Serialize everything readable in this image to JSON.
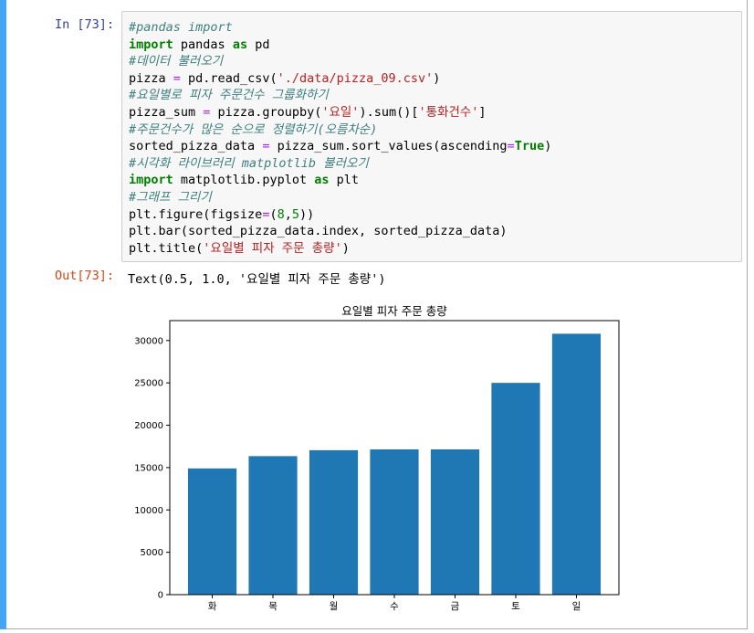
{
  "notebook": {
    "in_prompt": "In [73]:",
    "out_prompt": "Out[73]:",
    "code_lines": [
      [
        {
          "t": "#pandas import",
          "c": "cm-comment"
        }
      ],
      [
        {
          "t": "import",
          "c": "cm-keyword"
        },
        {
          "t": " pandas ",
          "c": ""
        },
        {
          "t": "as",
          "c": "cm-keyword"
        },
        {
          "t": " pd",
          "c": ""
        }
      ],
      [
        {
          "t": "#데이터 불러오기",
          "c": "cm-comment"
        }
      ],
      [
        {
          "t": "pizza ",
          "c": ""
        },
        {
          "t": "=",
          "c": "cm-operator"
        },
        {
          "t": " pd.read_csv(",
          "c": ""
        },
        {
          "t": "'./data/pizza_09.csv'",
          "c": "cm-string"
        },
        {
          "t": ")",
          "c": ""
        }
      ],
      [
        {
          "t": "#요일별로 피자 주문건수 그룹화하기",
          "c": "cm-comment"
        }
      ],
      [
        {
          "t": "pizza_sum ",
          "c": ""
        },
        {
          "t": "=",
          "c": "cm-operator"
        },
        {
          "t": " pizza.groupby(",
          "c": ""
        },
        {
          "t": "'요일'",
          "c": "cm-string"
        },
        {
          "t": ").sum()[",
          "c": ""
        },
        {
          "t": "'통화건수'",
          "c": "cm-string"
        },
        {
          "t": "]",
          "c": ""
        }
      ],
      [
        {
          "t": "#주문건수가 많은 순으로 정렬하기(오름차순)",
          "c": "cm-comment"
        }
      ],
      [
        {
          "t": "sorted_pizza_data ",
          "c": ""
        },
        {
          "t": "=",
          "c": "cm-operator"
        },
        {
          "t": " pizza_sum.sort_values(ascending",
          "c": ""
        },
        {
          "t": "=",
          "c": "cm-operator"
        },
        {
          "t": "True",
          "c": "cm-keyword"
        },
        {
          "t": ")",
          "c": ""
        }
      ],
      [
        {
          "t": "#시각화 라이브러리 matplotlib 불러오기",
          "c": "cm-comment"
        }
      ],
      [
        {
          "t": "import",
          "c": "cm-keyword"
        },
        {
          "t": " matplotlib.pyplot ",
          "c": ""
        },
        {
          "t": "as",
          "c": "cm-keyword"
        },
        {
          "t": " plt",
          "c": ""
        }
      ],
      [
        {
          "t": "#그래프 그리기",
          "c": "cm-comment"
        }
      ],
      [
        {
          "t": "plt.figure(figsize",
          "c": ""
        },
        {
          "t": "=",
          "c": "cm-operator"
        },
        {
          "t": "(",
          "c": ""
        },
        {
          "t": "8",
          "c": "cm-number"
        },
        {
          "t": ",",
          "c": ""
        },
        {
          "t": "5",
          "c": "cm-number"
        },
        {
          "t": "))",
          "c": ""
        }
      ],
      [
        {
          "t": "plt.bar(sorted_pizza_data.index, sorted_pizza_data)",
          "c": ""
        }
      ],
      [
        {
          "t": "plt.title(",
          "c": ""
        },
        {
          "t": "'요일별 피자 주문 총량'",
          "c": "cm-string"
        },
        {
          "t": ")",
          "c": ""
        }
      ]
    ],
    "output_text": "Text(0.5, 1.0, '요일별 피자 주문 총량')"
  },
  "colors": {
    "bar": "#1f77b4",
    "accent": "#42a5f5",
    "in_prompt": "#303f9f",
    "out_prompt": "#d84315"
  },
  "chart_data": {
    "type": "bar",
    "title": "요일별 피자 주문 총량",
    "xlabel": "",
    "ylabel": "",
    "categories": [
      "화",
      "목",
      "월",
      "수",
      "금",
      "토",
      "일"
    ],
    "values": [
      14900,
      16350,
      17050,
      17150,
      17150,
      25000,
      30800
    ],
    "ylim": [
      0,
      32350
    ],
    "yticks": [
      0,
      5000,
      10000,
      15000,
      20000,
      25000,
      30000
    ],
    "grid": false
  }
}
